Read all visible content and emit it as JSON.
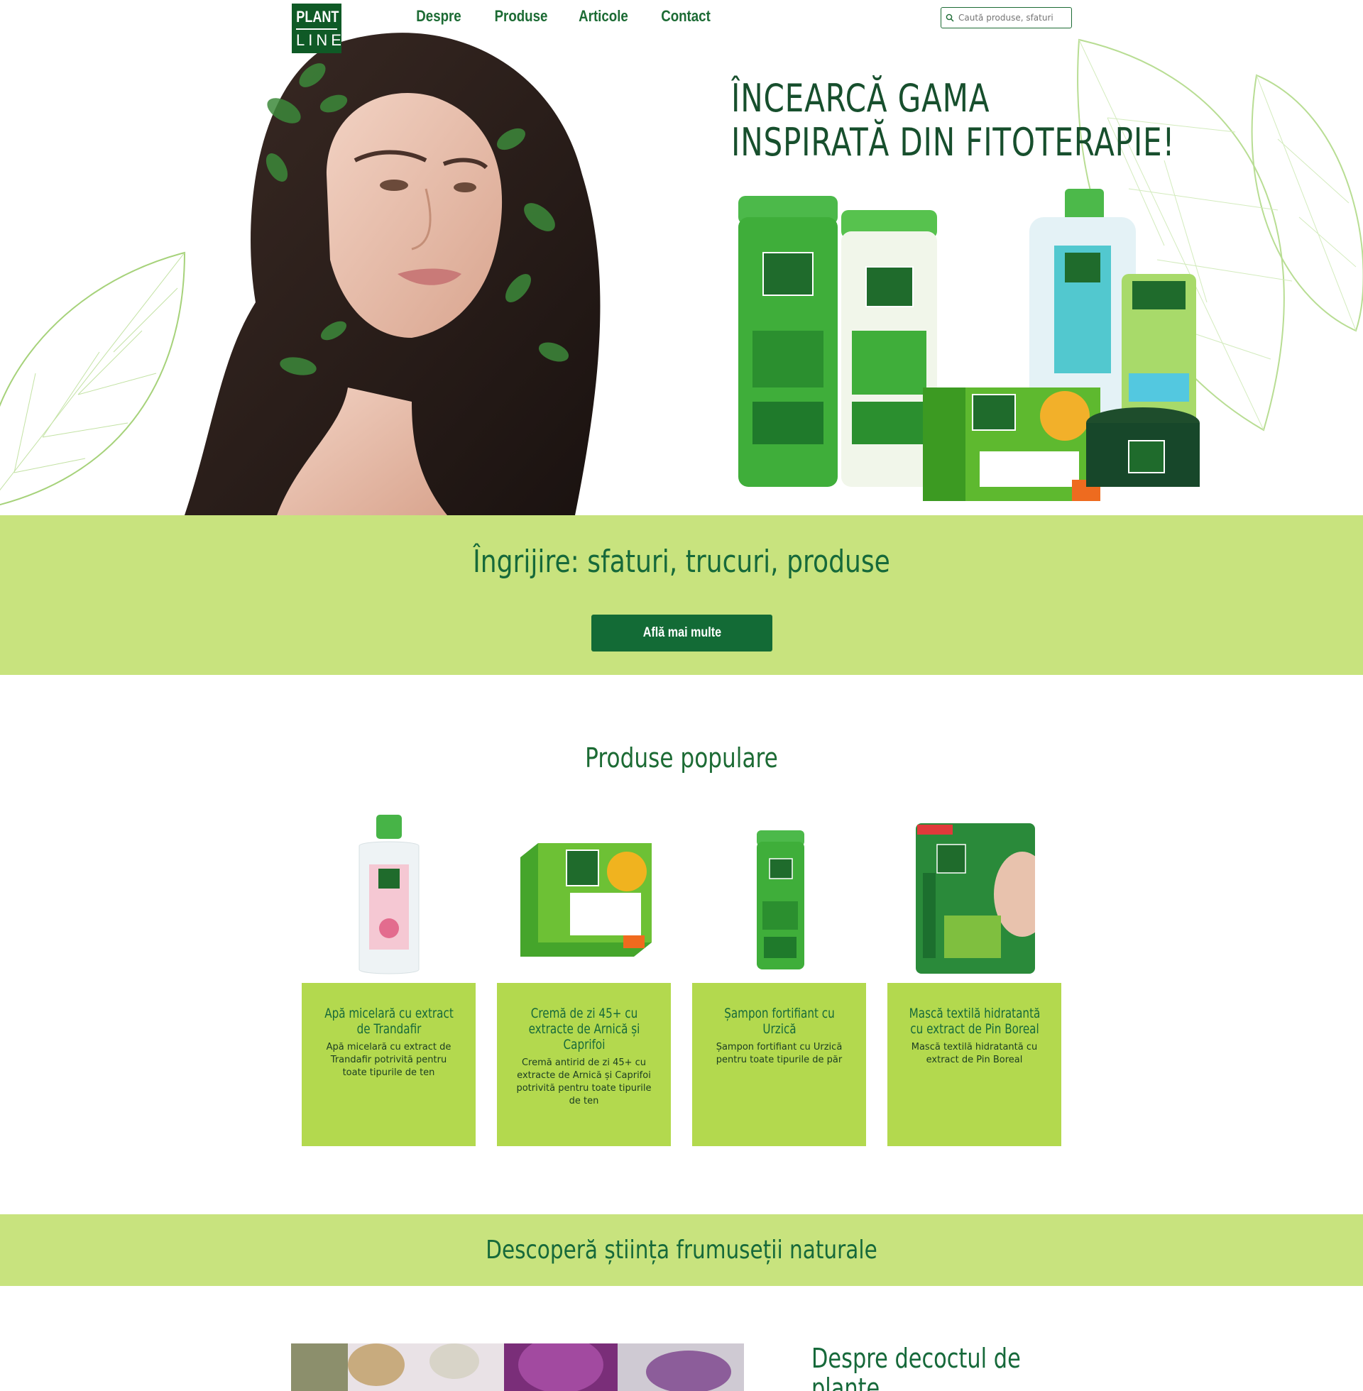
{
  "brand": {
    "logo_line1": "PLANT",
    "logo_line2": "LINE"
  },
  "nav": {
    "items": [
      "Despre",
      "Produse",
      "Articole",
      "Contact"
    ]
  },
  "search": {
    "placeholder": "Caută produse, sfaturi"
  },
  "hero": {
    "title_line1": "ÎNCEARCĂ GAMA",
    "title_line2": "INSPIRATĂ DIN FITOTERAPIE!"
  },
  "band1": {
    "title": "Îngrijire: sfaturi, trucuri, produse",
    "button": "Află mai multe"
  },
  "popular": {
    "title": "Produse populare",
    "products": [
      {
        "name": "Apă micelară cu extract de Trandafir",
        "desc": "Apă micelară cu extract de Trandafir potrivită pentru toate tipurile de ten"
      },
      {
        "name": "Cremă de zi 45+ cu extracte de Arnică și Caprifoi",
        "desc": "Cremă antirid de zi 45+ cu extracte de Arnică și Caprifoi potrivită pentru toate tipurile de ten"
      },
      {
        "name": "Șampon fortifiant cu Urzică",
        "desc": "Șampon fortifiant cu Urzică pentru toate tipurile de păr"
      },
      {
        "name": "Mască textilă hidratantă cu extract de Pin Boreal",
        "desc": "Mască textilă hidratantă cu extract de Pin Boreal"
      }
    ]
  },
  "band2": {
    "title": "Descoperă știința frumuseții naturale"
  },
  "article": {
    "title": "Despre decoctul de plante"
  },
  "colors": {
    "brand_green": "#136b36",
    "band_green": "#c8e37e",
    "card_green": "#b3d94e"
  }
}
